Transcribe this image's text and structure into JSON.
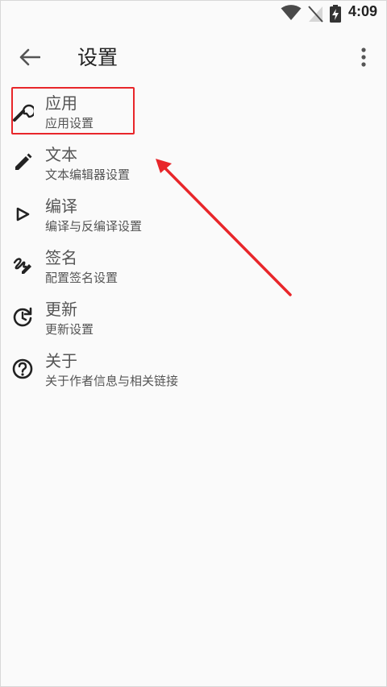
{
  "status_bar": {
    "time": "4:09",
    "icons": [
      "wifi-icon",
      "no-sim-icon",
      "battery-charging-icon"
    ]
  },
  "toolbar": {
    "title": "设置",
    "back_icon": "arrow-left-icon",
    "menu_icon": "more-vert-icon"
  },
  "items": [
    {
      "icon": "wrench-icon",
      "title": "应用",
      "subtitle": "应用设置"
    },
    {
      "icon": "pencil-icon",
      "title": "文本",
      "subtitle": "文本编辑器设置"
    },
    {
      "icon": "play-outline-icon",
      "title": "编译",
      "subtitle": "编译与反编译设置"
    },
    {
      "icon": "signature-icon",
      "title": "签名",
      "subtitle": "配置签名设置"
    },
    {
      "icon": "update-icon",
      "title": "更新",
      "subtitle": "更新设置"
    },
    {
      "icon": "help-circle-icon",
      "title": "关于",
      "subtitle": "关于作者信息与相关链接"
    }
  ],
  "annotation": {
    "color": "#e8262a",
    "highlighted_item": "应用"
  }
}
